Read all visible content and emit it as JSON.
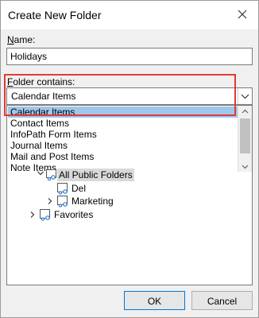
{
  "dialog": {
    "title": "Create New Folder"
  },
  "name_field": {
    "label": "Name:",
    "value": "Holidays"
  },
  "folder_contains": {
    "label": "Folder contains:",
    "selected": "Calendar Items",
    "options": [
      "Calendar Items",
      "Contact Items",
      "InfoPath Form Items",
      "Journal Items",
      "Mail and Post Items",
      "Note Items"
    ]
  },
  "tree": {
    "root": "All Public Folders",
    "children": [
      "Del",
      "Marketing"
    ],
    "favorites": "Favorites"
  },
  "buttons": {
    "ok": "OK",
    "cancel": "Cancel"
  },
  "colors": {
    "highlight_box": "#e53935",
    "selection": "#9fc7ea"
  }
}
